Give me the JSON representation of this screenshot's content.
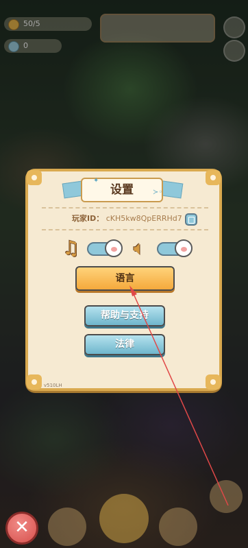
{
  "hud": {
    "stat1": "50/5",
    "stat2": "0"
  },
  "dialog": {
    "title": "设置",
    "player_id_label": "玩家ID：",
    "player_id_value": "cKH5kw8QpERRHd7",
    "music_icon": "music-note-icon",
    "sound_icon": "speaker-icon",
    "music_enabled": true,
    "sound_enabled": true,
    "buttons": {
      "language": "语言",
      "help": "帮助与支持",
      "legal": "法律"
    },
    "version": "v510LH"
  },
  "close_icon": "close-icon",
  "colors": {
    "dialog_bg": "#f6ead2",
    "dialog_border": "#d9a94f",
    "accent_blue": "#8fc8da",
    "accent_orange": "#f4a93c",
    "close_red": "#d7504c"
  }
}
